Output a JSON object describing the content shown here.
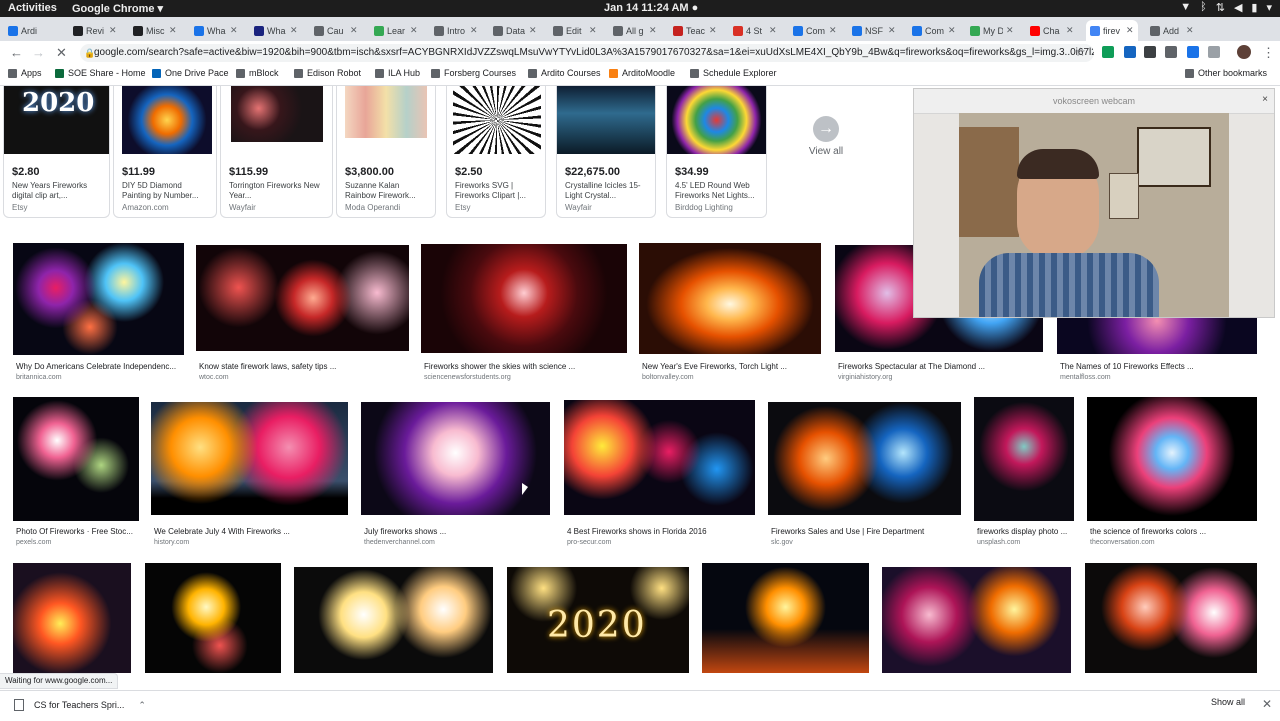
{
  "system": {
    "activities": "Activities",
    "app_menu": "Google Chrome ▾",
    "clock": "Jan 14  11:24 AM ●"
  },
  "tabs": [
    {
      "label": "Ardi",
      "color": "#1a73e8"
    },
    {
      "label": "Revi",
      "color": "#202124"
    },
    {
      "label": "Misc",
      "color": "#202124"
    },
    {
      "label": "Wha",
      "color": "#1a73e8"
    },
    {
      "label": "Wha",
      "color": "#1a237e"
    },
    {
      "label": "Cau",
      "color": "#5f6368"
    },
    {
      "label": "Lear",
      "color": "#34a853"
    },
    {
      "label": "Intro",
      "color": "#5f6368"
    },
    {
      "label": "Data",
      "color": "#5f6368"
    },
    {
      "label": "Edit",
      "color": "#5f6368"
    },
    {
      "label": "All g",
      "color": "#5f6368"
    },
    {
      "label": "Teac",
      "color": "#c5221f"
    },
    {
      "label": "4 St",
      "color": "#d93025"
    },
    {
      "label": "Com",
      "color": "#1a73e8"
    },
    {
      "label": "NSF",
      "color": "#1a73e8"
    },
    {
      "label": "Com",
      "color": "#1a73e8"
    },
    {
      "label": "My D",
      "color": "#34a853"
    },
    {
      "label": "Cha",
      "color": "#ff0000"
    },
    {
      "label": "firev",
      "color": "#4285f4"
    },
    {
      "label": "Add",
      "color": "#5f6368"
    }
  ],
  "address": {
    "url": "google.com/search?safe=active&biw=1920&bih=900&tbm=isch&sxsrf=ACYBGNRXIdJVZZswqLMsuVwYTYvLid0L3A%3A1579017670327&sa=1&ei=xuUdXsLME4XI_QbY9b_4Bw&q=fireworks&oq=fireworks&gs_l=img.3..0i67l2j0l3j0i67j0l4.1403..."
  },
  "bookmarks": [
    {
      "label": "Apps",
      "color": "#5f6368"
    },
    {
      "label": "SOE Share - Home",
      "color": "#0b6a3c"
    },
    {
      "label": "One Drive Pace",
      "color": "#0364b8"
    },
    {
      "label": "mBlock",
      "color": "#5f6368"
    },
    {
      "label": "Edison Robot",
      "color": "#5f6368"
    },
    {
      "label": "ILA Hub",
      "color": "#5f6368"
    },
    {
      "label": "Forsberg Courses",
      "color": "#5f6368"
    },
    {
      "label": "Ardito Courses",
      "color": "#5f6368"
    },
    {
      "label": "ArditoMoodle",
      "color": "#f98012"
    },
    {
      "label": "Schedule Explorer",
      "color": "#5f6368"
    }
  ],
  "other_bookmarks": "Other bookmarks",
  "shopping": [
    {
      "price": "$2.80",
      "title": "New Years Fireworks digital clip art,...",
      "store": "Etsy"
    },
    {
      "price": "$11.99",
      "title": "DIY 5D Diamond Painting by Number...",
      "store": "Amazon.com"
    },
    {
      "price": "$115.99",
      "title": "Torrington Fireworks New Year...",
      "store": "Wayfair"
    },
    {
      "price": "$3,800.00",
      "title": "Suzanne Kalan Rainbow Firework...",
      "store": "Moda Operandi"
    },
    {
      "price": "$2.50",
      "title": "Fireworks SVG | Fireworks Clipart |...",
      "store": "Etsy"
    },
    {
      "price": "$22,675.00",
      "title": "Crystalline Icicles 15-Light Crystal...",
      "store": "Wayfair"
    },
    {
      "price": "$34.99",
      "title": "4.5' LED Round Web Fireworks Net Lights...",
      "store": "Birddog Lighting"
    }
  ],
  "view_all": "View all",
  "results": [
    [
      {
        "caption": "Why Do Americans Celebrate Independenc...",
        "domain": "britannica.com"
      },
      {
        "caption": "Know state firework laws, safety tips ...",
        "domain": "wtoc.com"
      },
      {
        "caption": "Fireworks shower the skies with science ...",
        "domain": "sciencenewsforstudents.org"
      },
      {
        "caption": "New Year's Eve Fireworks, Torch Light ...",
        "domain": "boltonvalley.com"
      },
      {
        "caption": "Fireworks Spectacular at The Diamond ...",
        "domain": "virginiahistory.org"
      },
      {
        "caption": "The Names of 10 Fireworks Effects ...",
        "domain": "mentalfloss.com"
      }
    ],
    [
      {
        "caption": "Photo Of Fireworks · Free Stoc...",
        "domain": "pexels.com"
      },
      {
        "caption": "We Celebrate July 4 With Fireworks ...",
        "domain": "history.com"
      },
      {
        "caption": "July fireworks shows ...",
        "domain": "thedenverchannel.com"
      },
      {
        "caption": "4 Best Fireworks shows in Florida 2016",
        "domain": "pro-secur.com"
      },
      {
        "caption": "Fireworks Sales and Use | Fire Department",
        "domain": "slc.gov"
      },
      {
        "caption": "fireworks display photo ...",
        "domain": "unsplash.com"
      },
      {
        "caption": "the science of fireworks colors ...",
        "domain": "theconversation.com"
      }
    ]
  ],
  "image_text": {
    "top_2020": "2020",
    "row3_2020": "2020"
  },
  "webcam": {
    "title": "vokoscreen webcam",
    "close": "×"
  },
  "status": "Waiting for www.google.com...",
  "download": {
    "file": "CS for Teachers Spri...",
    "show_all": "Show all"
  }
}
